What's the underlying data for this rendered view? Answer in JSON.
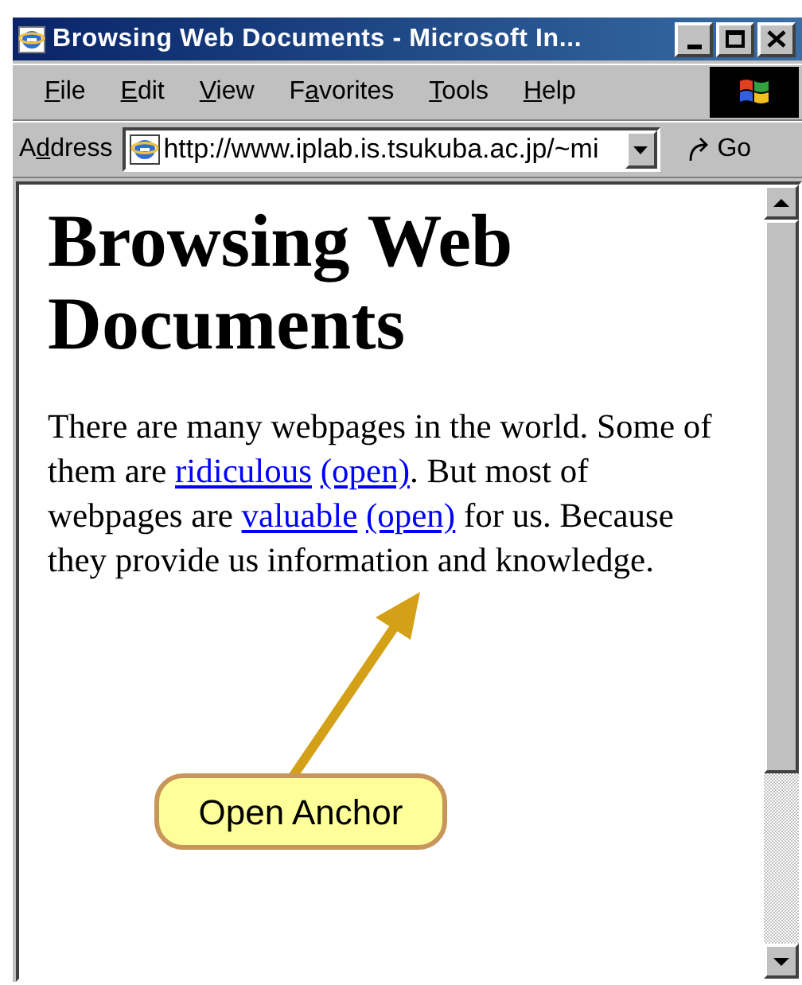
{
  "window": {
    "title": "Browsing Web Documents - Microsoft In..."
  },
  "menu": [
    {
      "access_key": "F",
      "rest": "ile"
    },
    {
      "access_key": "E",
      "rest": "dit"
    },
    {
      "access_key": "V",
      "rest": "iew"
    },
    {
      "before": "F",
      "access_key": "a",
      "rest": "vorites"
    },
    {
      "access_key": "T",
      "rest": "ools"
    },
    {
      "access_key": "H",
      "rest": "elp"
    }
  ],
  "address_bar": {
    "label": {
      "before": "A",
      "access_key": "d",
      "rest": "dress"
    },
    "value": "http://www.iplab.is.tsukuba.ac.jp/~mi",
    "go": "Go"
  },
  "page": {
    "heading": "Browsing Web Documents",
    "paragraph": [
      {
        "kind": "text",
        "text": "There are many webpages in the world. Some of them are "
      },
      {
        "kind": "link",
        "text": "ridiculous"
      },
      {
        "kind": "link",
        "text": "(open)"
      },
      {
        "kind": "text",
        "text": ". But most of webpages are "
      },
      {
        "kind": "link",
        "text": "valuable"
      },
      {
        "kind": "link",
        "text": "(open)"
      },
      {
        "kind": "text",
        "text": " for us. Because they provide us information and knowledge."
      }
    ]
  },
  "annotation": {
    "label": "Open Anchor"
  }
}
